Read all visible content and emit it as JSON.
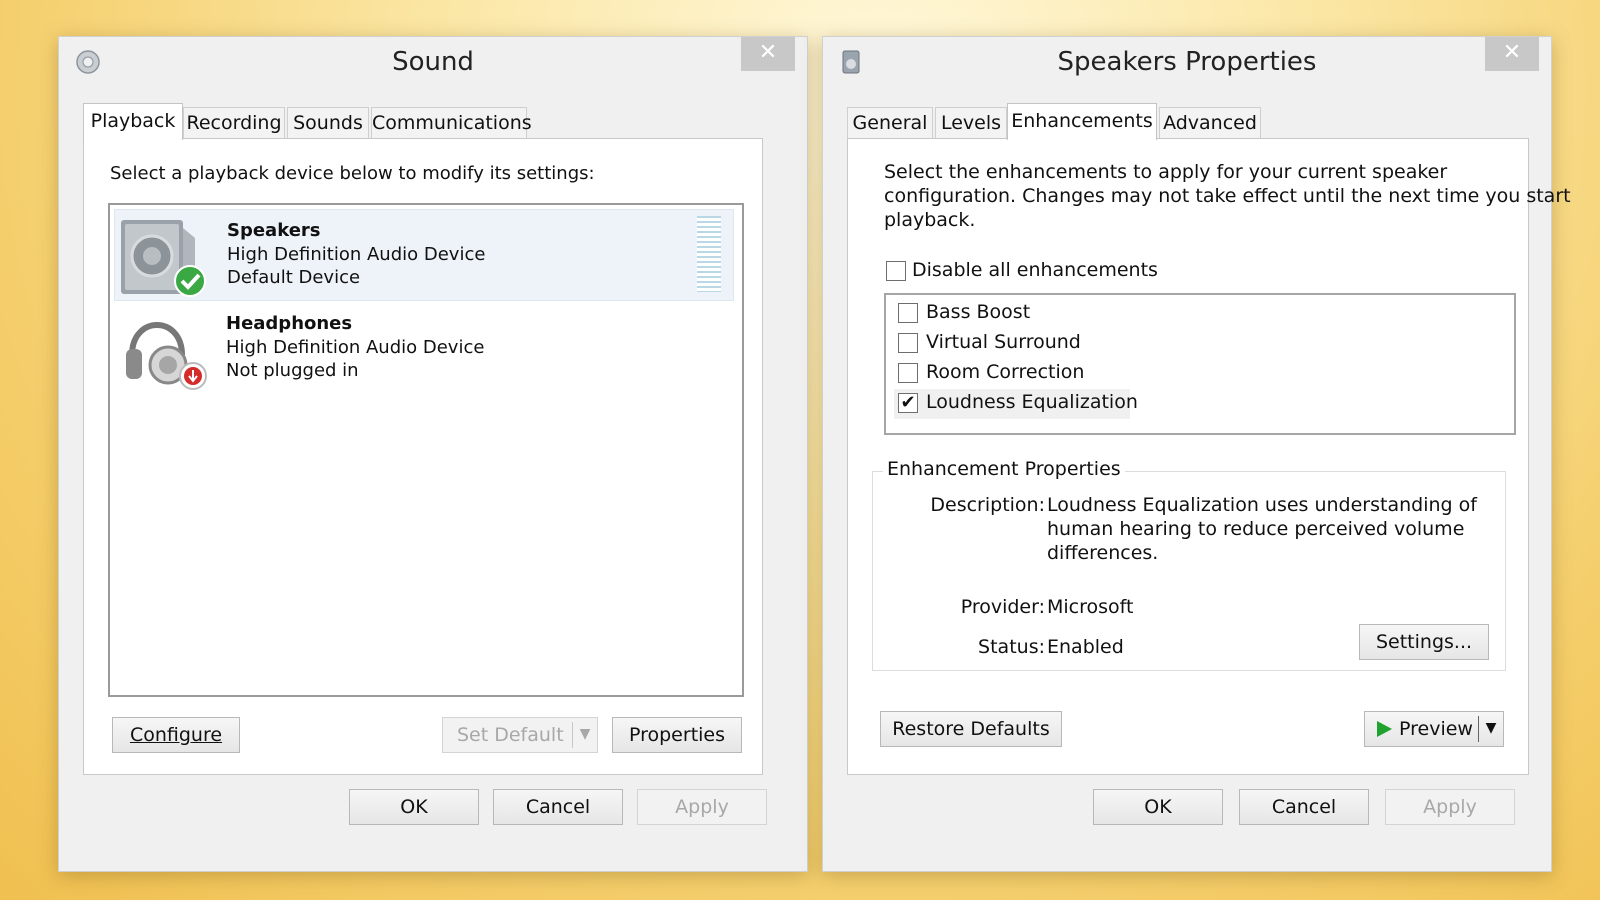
{
  "sound": {
    "title": "Sound",
    "close_glyph": "✕",
    "tabs": [
      "Playback",
      "Recording",
      "Sounds",
      "Communications"
    ],
    "instruction": "Select a playback device below to modify its settings:",
    "devices": [
      {
        "name": "Speakers",
        "desc": "High Definition Audio Device",
        "status": "Default Device",
        "icon": "speaker-icon",
        "badge": "default-check-icon"
      },
      {
        "name": "Headphones",
        "desc": "High Definition Audio Device",
        "status": "Not plugged in",
        "icon": "headphones-icon",
        "badge": "unplugged-icon"
      }
    ],
    "buttons": {
      "configure": "Configure",
      "set_default": "Set Default",
      "properties": "Properties",
      "ok": "OK",
      "cancel": "Cancel",
      "apply": "Apply"
    }
  },
  "props": {
    "title": "Speakers Properties",
    "close_glyph": "✕",
    "tabs": [
      "General",
      "Levels",
      "Enhancements",
      "Advanced"
    ],
    "instruction_lines": [
      "Select the enhancements to apply for your current speaker",
      "configuration. Changes may not take effect until the next time you start",
      "playback."
    ],
    "disable_all": {
      "label": "Disable all enhancements",
      "checked": false
    },
    "enhancements": [
      {
        "label": "Bass Boost",
        "checked": false
      },
      {
        "label": "Virtual Surround",
        "checked": false
      },
      {
        "label": "Room Correction",
        "checked": false
      },
      {
        "label": "Loudness Equalization",
        "checked": true
      }
    ],
    "properties_group": {
      "title": "Enhancement Properties",
      "description_label": "Description:",
      "description_lines": [
        "Loudness Equalization uses understanding of",
        "human hearing to reduce perceived volume",
        "differences."
      ],
      "provider_label": "Provider:",
      "provider": "Microsoft",
      "status_label": "Status:",
      "status": "Enabled",
      "settings_button": "Settings..."
    },
    "buttons": {
      "restore_defaults": "Restore Defaults",
      "preview": "Preview",
      "ok": "OK",
      "cancel": "Cancel",
      "apply": "Apply"
    }
  },
  "colors": {
    "check_green": "#3aa843",
    "unplugged_red": "#d42b2b",
    "selected_row": "#eef3f9",
    "preview_green": "#1fa22e"
  }
}
